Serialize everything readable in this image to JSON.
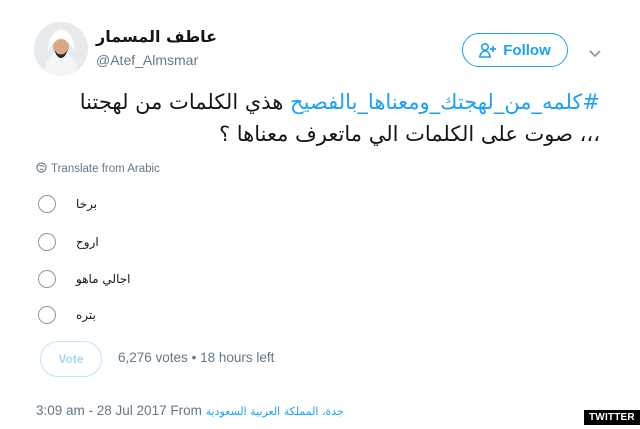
{
  "author": {
    "display_name": "عاطف المسمار",
    "handle": "@Atef_Almsmar"
  },
  "follow_button": {
    "label": "Follow",
    "icon": "person-add-icon"
  },
  "tweet": {
    "hashtag": "#كلمه_من_لهجتك_ومعناها_بالفصيح",
    "text_line1": " هذي الكلمات من لهجتنا",
    "text_line2": "،،، صوت على الكلمات الي ماتعرف معناها ؟"
  },
  "translate": {
    "label": "Translate from Arabic",
    "icon": "globe-icon"
  },
  "poll": {
    "options": [
      {
        "label": "برخا"
      },
      {
        "label": "اروح"
      },
      {
        "label": "اجالي ماهو"
      },
      {
        "label": "بتره"
      }
    ],
    "vote_label": "Vote",
    "votes": "6,276 votes",
    "separator": "•",
    "time_left": "18 hours left"
  },
  "timestamp": {
    "time_date": "3:09 am - 28 Jul 2017 From",
    "location": "جدة، المملكة العربية السعودية"
  },
  "watermark": "TWITTER",
  "colors": {
    "accent": "#1da1f2",
    "text": "#14171a",
    "muted": "#657786"
  }
}
